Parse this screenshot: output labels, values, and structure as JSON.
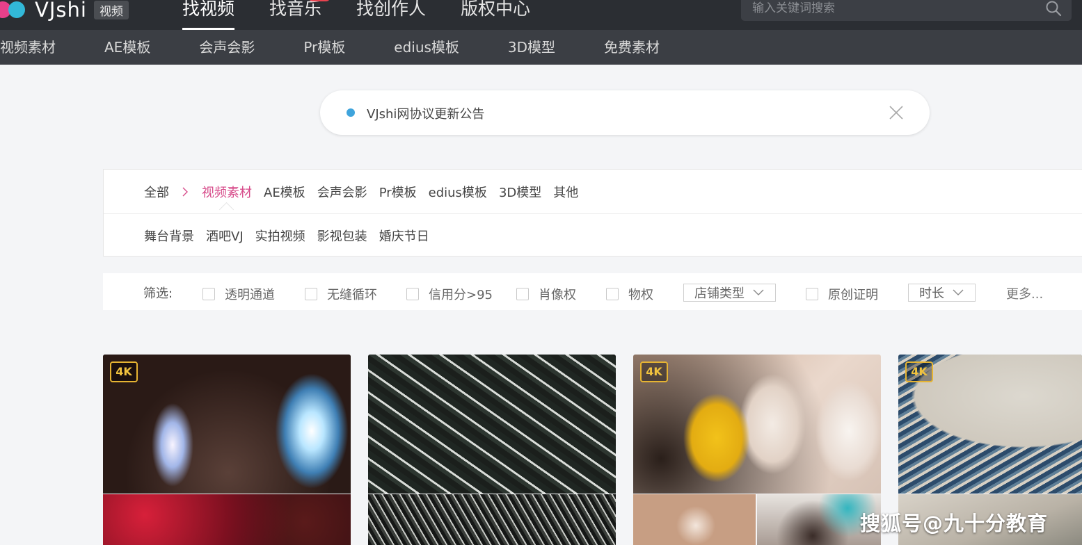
{
  "header": {
    "logo_text": "VJshi",
    "logo_tag": "视频",
    "nav": [
      {
        "label": "找视频",
        "active": true
      },
      {
        "label": "找音乐",
        "active": false,
        "badge": true
      },
      {
        "label": "找创作人",
        "active": false
      },
      {
        "label": "版权中心",
        "active": false
      }
    ],
    "search": {
      "placeholder": "输入关键词搜索"
    }
  },
  "subnav": [
    "视频素材",
    "AE模板",
    "会声会影",
    "Pr模板",
    "edius模板",
    "3D模型",
    "免费素材"
  ],
  "notice": {
    "text": "VJshi网协议更新公告"
  },
  "categories": {
    "root": "全部",
    "row1": [
      {
        "label": "视频素材",
        "active": true
      },
      {
        "label": "AE模板"
      },
      {
        "label": "会声会影"
      },
      {
        "label": "Pr模板"
      },
      {
        "label": "edius模板"
      },
      {
        "label": "3D模型"
      },
      {
        "label": "其他"
      }
    ],
    "row2": [
      "舞台背景",
      "酒吧VJ",
      "实拍视频",
      "影视包装",
      "婚庆节日"
    ]
  },
  "filters": {
    "label": "筛选:",
    "checkboxes": [
      "透明通道",
      "无缝循环",
      "信用分>95",
      "肖像权",
      "物权"
    ],
    "store_type": "店铺类型",
    "original": "原创证明",
    "duration": "时长",
    "more": "更多..."
  },
  "cards": [
    {
      "badge": "4K"
    },
    {
      "badge": ""
    },
    {
      "badge": "4K"
    },
    {
      "badge": "4K"
    }
  ],
  "watermark": "搜狐号@九十分教育",
  "colors": {
    "accent": "#d74b8a",
    "header_bg": "#2b2e33",
    "subnav_bg": "#3b3e44",
    "badge_gold": "#e6b432"
  }
}
